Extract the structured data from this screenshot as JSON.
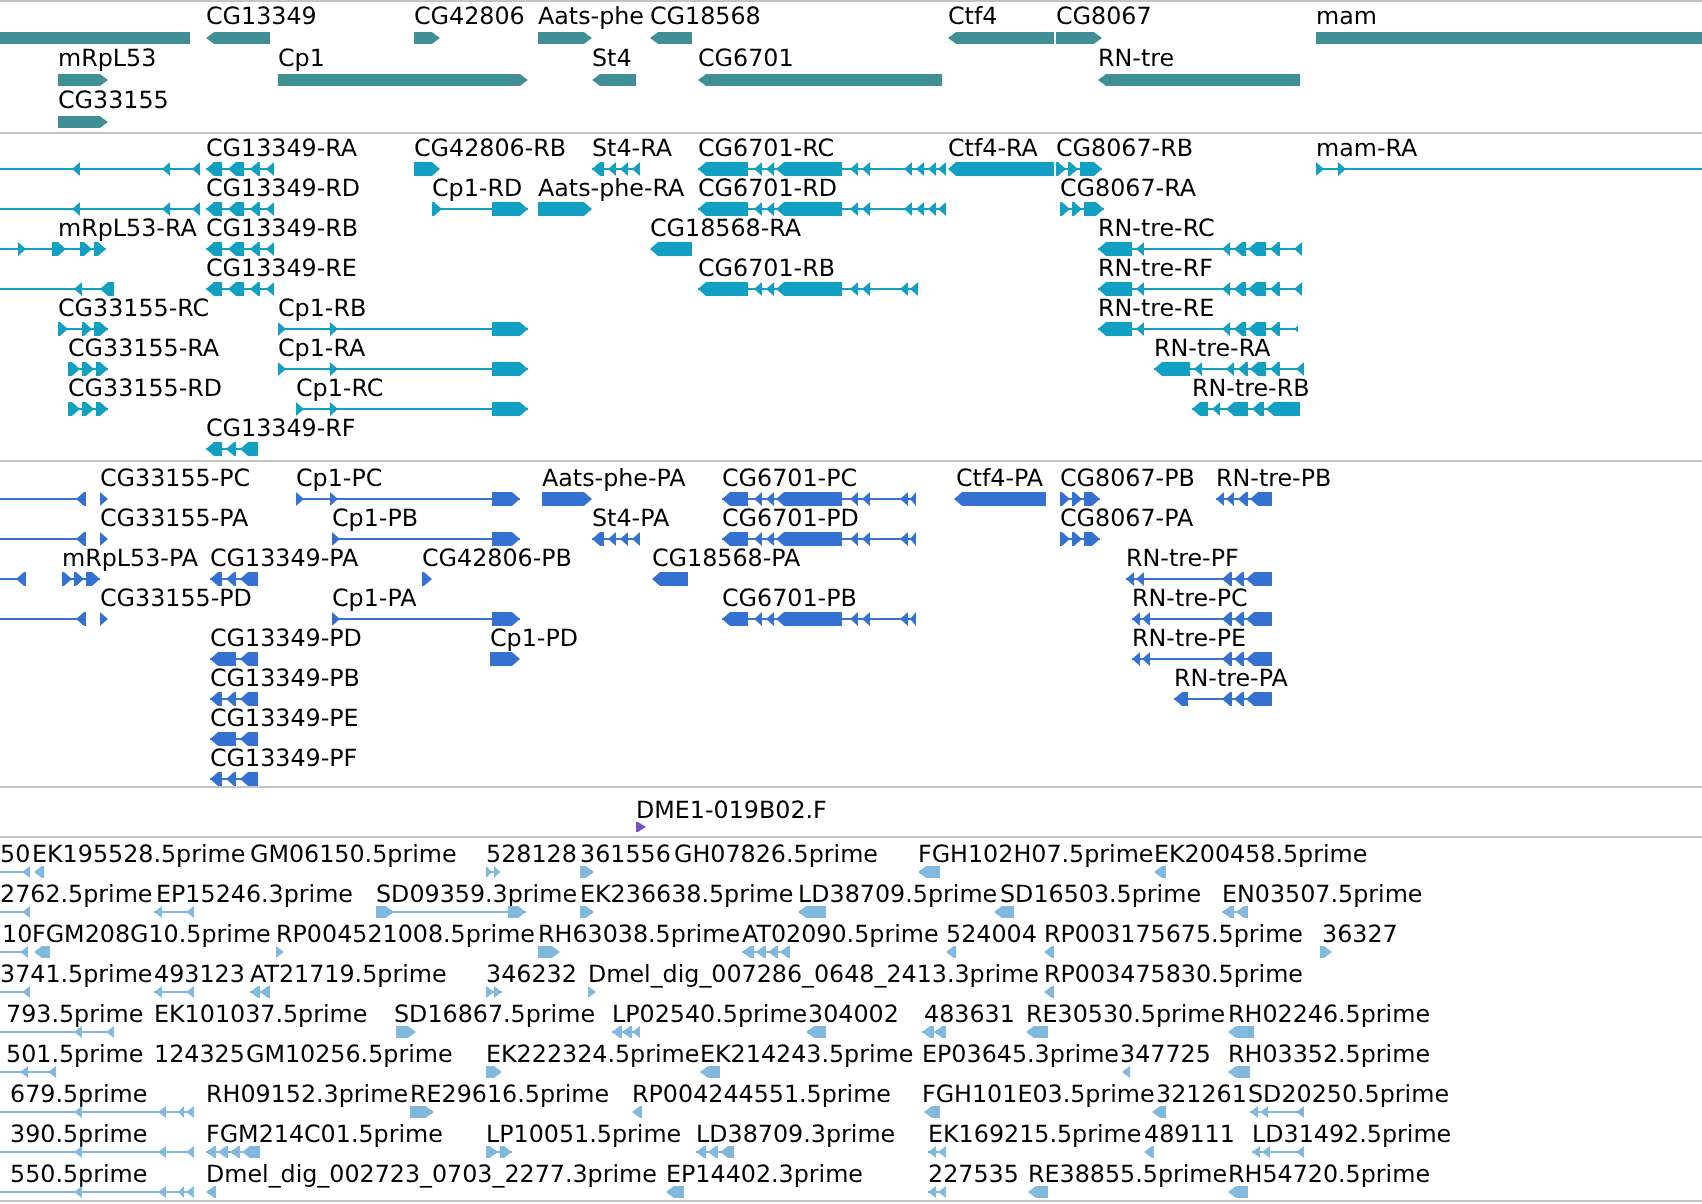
{
  "tracks": [
    {
      "kind": "gene",
      "rows": [
        {
          "features": [
            {
              "reverse": true
            },
            {
              "label": "CG13349",
              "reverse": true
            },
            {
              "label": "CG42806",
              "reverse": false
            },
            {
              "label": "Aats-phe",
              "reverse": false
            },
            {
              "label": "CG18568",
              "reverse": true
            },
            {
              "label": "Ctf4",
              "reverse": true
            },
            {
              "label": "CG8067",
              "reverse": false
            },
            {
              "label": "mam",
              "reverse": false
            }
          ]
        },
        {
          "features": [
            {
              "label": "mRpL53",
              "reverse": false
            },
            {
              "label": "Cp1",
              "reverse": false
            },
            {
              "label": "St4",
              "reverse": true
            },
            {
              "label": "CG6701",
              "reverse": true
            },
            {
              "label": "RN-tre",
              "reverse": true
            }
          ]
        },
        {
          "features": [
            {
              "label": "CG33155",
              "reverse": false
            }
          ]
        }
      ]
    },
    {
      "kind": "transcript",
      "rows": [
        {
          "features": [
            {
              "reverse": true
            },
            {
              "label": "CG13349-RA",
              "reverse": true
            },
            {
              "label": "CG42806-RB",
              "reverse": false
            },
            {
              "label": "St4-RA",
              "reverse": true
            },
            {
              "label": "CG6701-RC",
              "reverse": true
            },
            {
              "label": "Ctf4-RA",
              "reverse": true
            },
            {
              "label": "CG8067-RB",
              "reverse": false
            },
            {
              "label": "mam-RA",
              "reverse": false
            }
          ]
        },
        {
          "features": [
            {
              "reverse": true
            },
            {
              "label": "CG13349-RD",
              "reverse": true
            },
            {
              "label": "Cp1-RD",
              "reverse": false
            },
            {
              "label": "Aats-phe-RA",
              "reverse": false
            },
            {
              "label": "CG6701-RD",
              "reverse": true
            },
            {
              "label": "CG8067-RA",
              "reverse": false
            }
          ]
        },
        {
          "features": [
            {
              "label": "mRpL53-RA",
              "reverse": false
            },
            {
              "label": "CG13349-RB",
              "reverse": true
            },
            {
              "label": "CG18568-RA",
              "reverse": true
            },
            {
              "label": "RN-tre-RC",
              "reverse": true
            }
          ]
        },
        {
          "features": [
            {
              "reverse": true
            },
            {
              "label": "CG13349-RE",
              "reverse": true
            },
            {
              "label": "CG6701-RB",
              "reverse": true
            },
            {
              "label": "RN-tre-RF",
              "reverse": true
            }
          ]
        },
        {
          "features": [
            {
              "label": "CG33155-RC",
              "reverse": false
            },
            {
              "label": "Cp1-RB",
              "reverse": false
            },
            {
              "label": "RN-tre-RE",
              "reverse": true
            }
          ]
        },
        {
          "features": [
            {
              "label": "CG33155-RA",
              "reverse": false
            },
            {
              "label": "Cp1-RA",
              "reverse": false
            },
            {
              "label": "RN-tre-RA",
              "reverse": true
            }
          ]
        },
        {
          "features": [
            {
              "label": "CG33155-RD",
              "reverse": false
            },
            {
              "label": "Cp1-RC",
              "reverse": false
            },
            {
              "label": "RN-tre-RB",
              "reverse": true
            }
          ]
        },
        {
          "features": [
            {
              "label": "CG13349-RF",
              "reverse": true
            }
          ]
        }
      ]
    },
    {
      "kind": "polypeptide",
      "rows": [
        {
          "features": [
            {
              "reverse": true
            },
            {
              "label": "CG33155-PC",
              "reverse": false
            },
            {
              "label": "Cp1-PC",
              "reverse": false
            },
            {
              "label": "Aats-phe-PA",
              "reverse": false
            },
            {
              "label": "CG6701-PC",
              "reverse": true
            },
            {
              "label": "Ctf4-PA",
              "reverse": true
            },
            {
              "label": "CG8067-PB",
              "reverse": false
            },
            {
              "label": "RN-tre-PB",
              "reverse": true
            }
          ]
        },
        {
          "features": [
            {
              "reverse": true
            },
            {
              "label": "CG33155-PA",
              "reverse": false
            },
            {
              "label": "Cp1-PB",
              "reverse": false
            },
            {
              "label": "St4-PA",
              "reverse": true
            },
            {
              "label": "CG6701-PD",
              "reverse": true
            },
            {
              "label": "CG8067-PA",
              "reverse": false
            }
          ]
        },
        {
          "features": [
            {
              "reverse": true
            },
            {
              "label": "mRpL53-PA",
              "reverse": false
            },
            {
              "label": "CG13349-PA",
              "reverse": true
            },
            {
              "label": "CG42806-PB",
              "reverse": false
            },
            {
              "label": "CG18568-PA",
              "reverse": true
            },
            {
              "label": "RN-tre-PF",
              "reverse": true
            }
          ]
        },
        {
          "features": [
            {
              "reverse": true
            },
            {
              "label": "CG33155-PD",
              "reverse": false
            },
            {
              "label": "Cp1-PA",
              "reverse": false
            },
            {
              "label": "CG6701-PB",
              "reverse": true
            },
            {
              "label": "RN-tre-PC",
              "reverse": true
            }
          ]
        },
        {
          "features": [
            {
              "label": "CG13349-PD",
              "reverse": true
            },
            {
              "label": "Cp1-PD",
              "reverse": false
            },
            {
              "label": "RN-tre-PE",
              "reverse": true
            }
          ]
        },
        {
          "features": [
            {
              "label": "CG13349-PB",
              "reverse": true
            },
            {
              "label": "RN-tre-PA",
              "reverse": true
            }
          ]
        },
        {
          "features": [
            {
              "label": "CG13349-PE",
              "reverse": true
            }
          ]
        },
        {
          "features": [
            {
              "label": "CG13349-PF",
              "reverse": true
            }
          ]
        }
      ]
    },
    {
      "kind": "clone",
      "rows": [
        {
          "features": [
            {
              "label": "DME1-019B02.F",
              "reverse": false
            }
          ]
        }
      ]
    },
    {
      "kind": "est",
      "rows": [
        {
          "features": [
            {
              "label": "50",
              "reverse": true
            },
            {
              "label": "EK195528.5prime",
              "reverse": true
            },
            {
              "label": "GM06150.5prime"
            },
            {
              "label": "528128",
              "reverse": false
            },
            {
              "label": "361556",
              "reverse": false
            },
            {
              "label": "GH07826.5prime"
            },
            {
              "label": "FGH102H07.5prime",
              "reverse": true
            },
            {
              "label": "EK200458.5prime",
              "reverse": true
            }
          ]
        },
        {
          "features": [
            {
              "label": "2762.5prime",
              "reverse": true
            },
            {
              "label": "EP15246.3prime",
              "reverse": true
            },
            {
              "label": "SD09359.3prime",
              "reverse": false
            },
            {
              "label": "EK236638.5prime",
              "reverse": false
            },
            {
              "label": "LD38709.5prime",
              "reverse": true
            },
            {
              "label": "SD16503.5prime",
              "reverse": true
            },
            {
              "label": "EN03507.5prime",
              "reverse": true
            }
          ]
        },
        {
          "features": [
            {
              "label": "10",
              "reverse": true
            },
            {
              "label": "FGM208G10.5prime",
              "reverse": true
            },
            {
              "label": "RP004521008.5prime",
              "reverse": false
            },
            {
              "label": "RH63038.5prime",
              "reverse": false
            },
            {
              "label": "AT02090.5prime",
              "reverse": true
            },
            {
              "label": "524004",
              "reverse": true
            },
            {
              "label": "RP003175675.5prime",
              "reverse": true
            },
            {
              "label": "36327",
              "reverse": false
            }
          ]
        },
        {
          "features": [
            {
              "label": "3741.5prime",
              "reverse": true
            },
            {
              "label": "493123",
              "reverse": true
            },
            {
              "label": "AT21719.5prime",
              "reverse": true
            },
            {
              "label": "346232",
              "reverse": false
            },
            {
              "label": "Dmel_dig_007286_0648_2413.3prime",
              "reverse": false
            },
            {
              "label": "RP003475830.5prime",
              "reverse": true
            }
          ]
        },
        {
          "features": [
            {
              "label": "793.5prime",
              "reverse": true
            },
            {
              "label": "EK101037.5prime"
            },
            {
              "label": "SD16867.5prime",
              "reverse": false
            },
            {
              "label": "LP02540.5prime",
              "reverse": true
            },
            {
              "label": "304002",
              "reverse": true
            },
            {
              "label": "483631",
              "reverse": true
            },
            {
              "label": "RE30530.5prime",
              "reverse": true
            },
            {
              "label": "RH02246.5prime",
              "reverse": true
            }
          ]
        },
        {
          "features": [
            {
              "label": "501.5prime",
              "reverse": true
            },
            {
              "label": "124325"
            },
            {
              "label": "GM10256.5prime"
            },
            {
              "label": "EK222324.5prime",
              "reverse": false
            },
            {
              "label": "EK214243.5prime",
              "reverse": true
            },
            {
              "label": "EP03645.3prime"
            },
            {
              "label": "347725",
              "reverse": true
            },
            {
              "label": "RH03352.5prime",
              "reverse": true
            }
          ]
        },
        {
          "features": [
            {
              "label": "679.5prime",
              "reverse": true
            },
            {
              "label": "RH09152.3prime"
            },
            {
              "label": "RE29616.5prime",
              "reverse": false
            },
            {
              "label": "RP004244551.5prime",
              "reverse": true
            },
            {
              "label": "FGH101E03.5prime",
              "reverse": true
            },
            {
              "label": "321261",
              "reverse": true
            },
            {
              "label": "SD20250.5prime",
              "reverse": true
            }
          ]
        },
        {
          "features": [
            {
              "label": "390.5prime",
              "reverse": true
            },
            {
              "label": "FGM214C01.5prime",
              "reverse": true
            },
            {
              "label": "LP10051.5prime",
              "reverse": false
            },
            {
              "label": "LD38709.3prime",
              "reverse": true
            },
            {
              "label": "EK169215.5prime",
              "reverse": true
            },
            {
              "label": "489111",
              "reverse": true
            },
            {
              "label": "LD31492.5prime",
              "reverse": true
            }
          ]
        },
        {
          "features": [
            {
              "label": "550.5prime",
              "reverse": true
            },
            {
              "label": "Dmel_dig_002723_0703_2277.3prime",
              "reverse": true
            },
            {
              "label": "EP14402.3prime",
              "reverse": true
            },
            {
              "label": "227535",
              "reverse": true
            },
            {
              "label": "RE38855.5prime",
              "reverse": true
            },
            {
              "label": "RH54720.5prime",
              "reverse": true
            }
          ]
        }
      ]
    }
  ]
}
